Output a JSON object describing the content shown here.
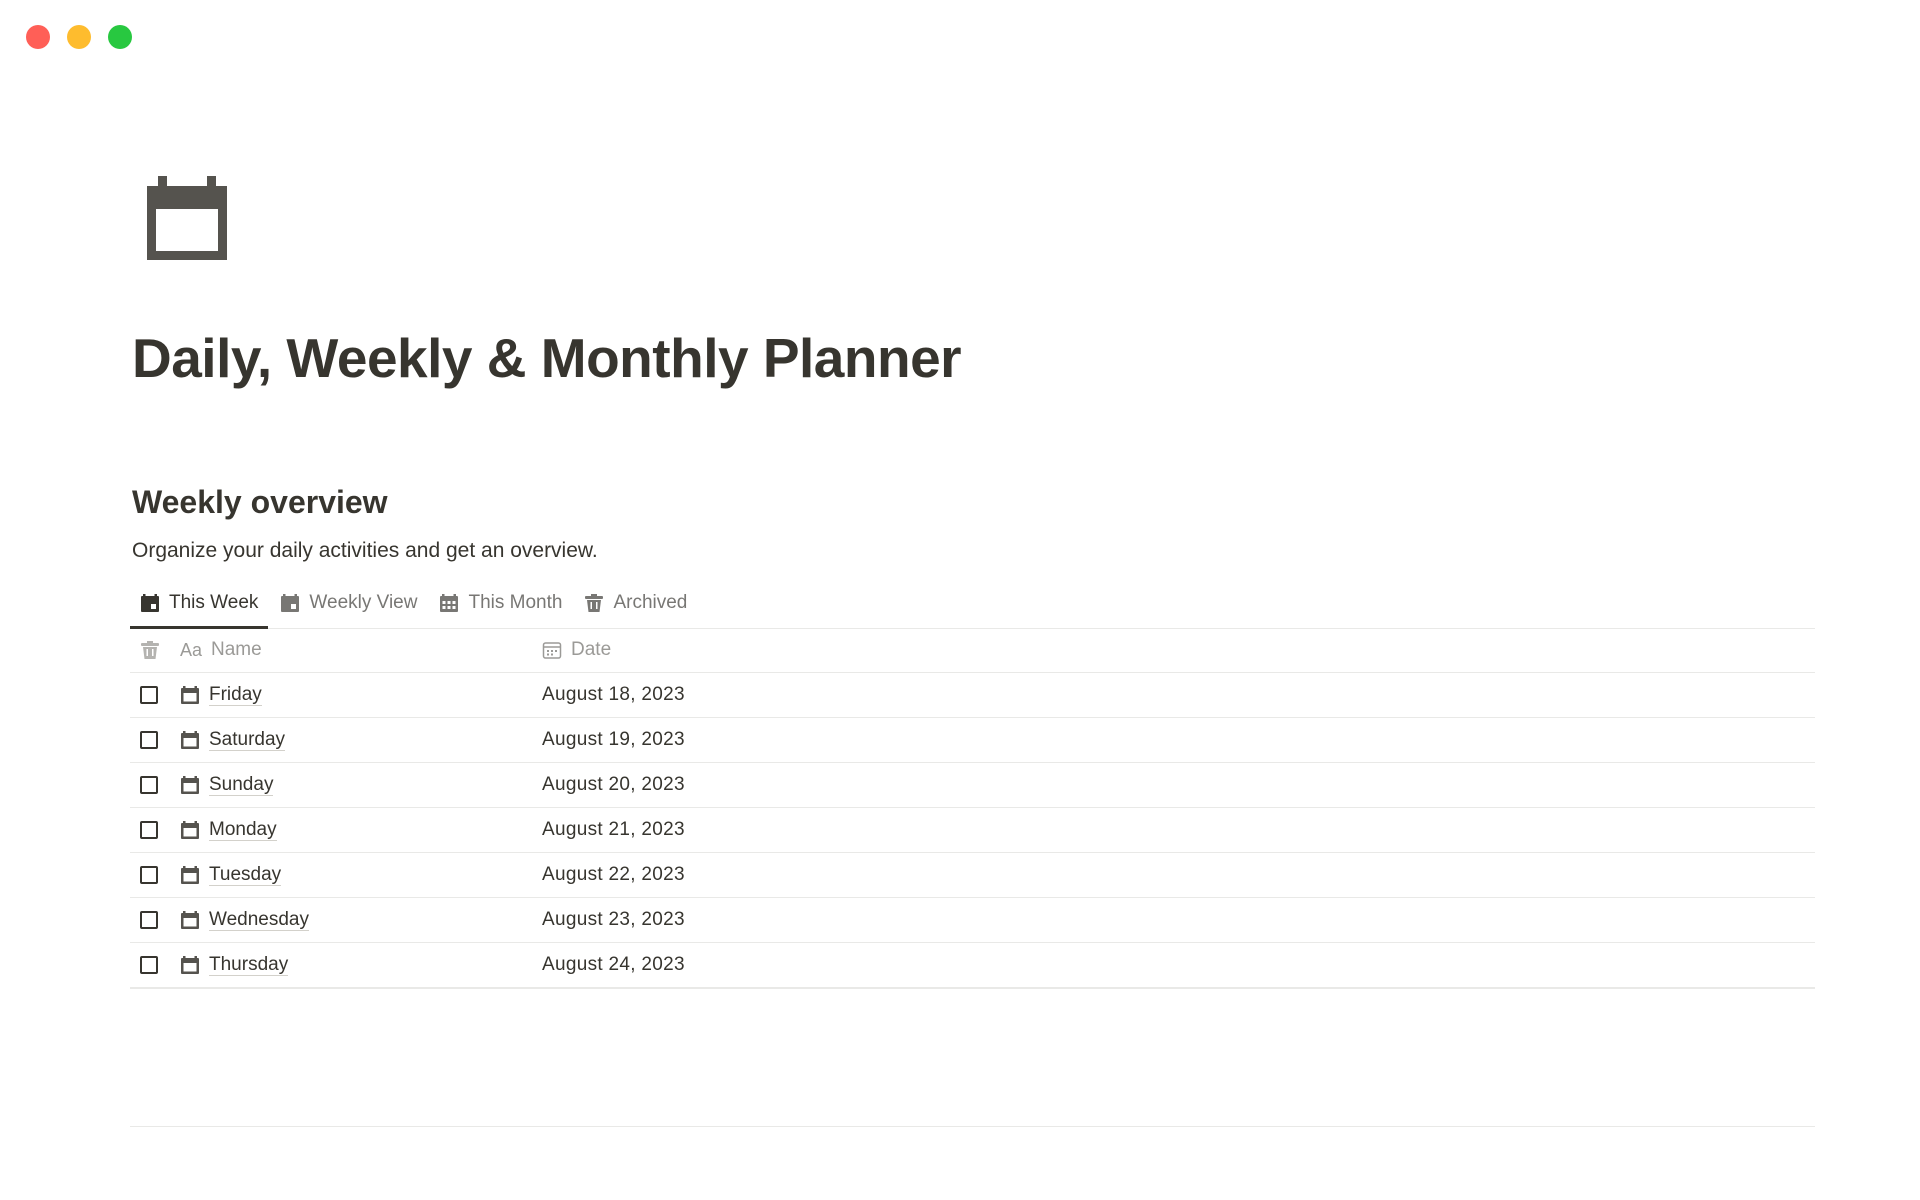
{
  "window": {
    "controls": [
      "close",
      "minimize",
      "zoom"
    ]
  },
  "page": {
    "icon": "calendar-icon",
    "title": "Daily, Weekly & Monthly Planner"
  },
  "section": {
    "heading": "Weekly overview",
    "description": "Organize your daily activities and get an overview."
  },
  "tabs": [
    {
      "label": "This Week",
      "icon": "calendar-icon",
      "active": true
    },
    {
      "label": "Weekly View",
      "icon": "calendar-icon",
      "active": false
    },
    {
      "label": "This Month",
      "icon": "calendar-grid-icon",
      "active": false
    },
    {
      "label": "Archived",
      "icon": "trash-icon",
      "active": false
    }
  ],
  "table": {
    "headers": {
      "check_icon": "trash-icon",
      "name_prefix": "Aa",
      "name": "Name",
      "date_icon": "calendar-outline-icon",
      "date": "Date"
    },
    "rows": [
      {
        "name": "Friday",
        "date": "August 18, 2023",
        "checked": false
      },
      {
        "name": "Saturday",
        "date": "August 19, 2023",
        "checked": false
      },
      {
        "name": "Sunday",
        "date": "August 20, 2023",
        "checked": false
      },
      {
        "name": "Monday",
        "date": "August 21, 2023",
        "checked": false
      },
      {
        "name": "Tuesday",
        "date": "August 22, 2023",
        "checked": false
      },
      {
        "name": "Wednesday",
        "date": "August 23, 2023",
        "checked": false
      },
      {
        "name": "Thursday",
        "date": "August 24, 2023",
        "checked": false
      }
    ]
  },
  "colors": {
    "text": "#37352f",
    "muted": "#787774",
    "divider": "#e9e9e7",
    "close": "#ff5f57",
    "minimize": "#febc2e",
    "zoom": "#28c840"
  }
}
